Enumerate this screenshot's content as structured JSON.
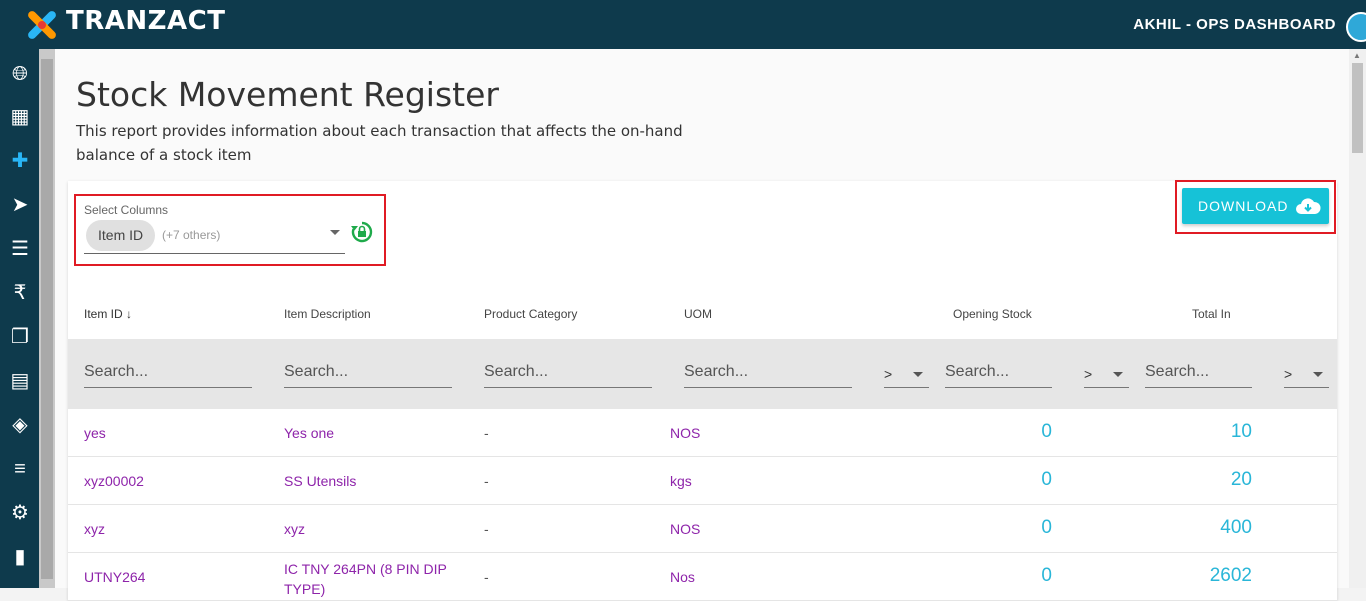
{
  "header": {
    "brand": "TRANZACT",
    "user": "AKHIL - OPS DASHBOARD"
  },
  "sidebar": {
    "icons": [
      "globe-icon",
      "building-icon",
      "plus-cross-icon",
      "send-icon",
      "list-icon",
      "rupee-icon",
      "documents-icon",
      "report-icon",
      "box-icon",
      "menu-arrow-icon",
      "tools-icon",
      "book-icon"
    ]
  },
  "page": {
    "title": "Stock Movement Register",
    "description": "This report provides information about each transaction that affects the on-hand balance of a stock item"
  },
  "columns_select": {
    "label": "Select Columns",
    "chip": "Item ID",
    "others": "(+7 others)"
  },
  "download": {
    "label": "DOWNLOAD"
  },
  "table": {
    "headers": [
      "Item ID",
      "Item Description",
      "Product Category",
      "UOM",
      "Opening Stock",
      "Total In"
    ],
    "sort_indicator": "↓",
    "search_placeholder": "Search...",
    "operator": ">",
    "rows": [
      {
        "item_id": "yes",
        "description": "Yes one",
        "category": "-",
        "uom": "NOS",
        "opening": "0",
        "total_in": "10"
      },
      {
        "item_id": "xyz00002",
        "description": "SS Utensils",
        "category": "-",
        "uom": "kgs",
        "opening": "0",
        "total_in": "20"
      },
      {
        "item_id": "xyz",
        "description": "xyz",
        "category": "-",
        "uom": "NOS",
        "opening": "0",
        "total_in": "400"
      },
      {
        "item_id": "UTNY264",
        "description": "IC TNY 264PN (8 PIN DIP TYPE)",
        "category": "-",
        "uom": "Nos",
        "opening": "0",
        "total_in": "2602"
      }
    ]
  },
  "colors": {
    "topbar": "#0e3a4c",
    "accent": "#16c2d7",
    "link": "#8e24aa",
    "highlight": "#e01b24"
  }
}
